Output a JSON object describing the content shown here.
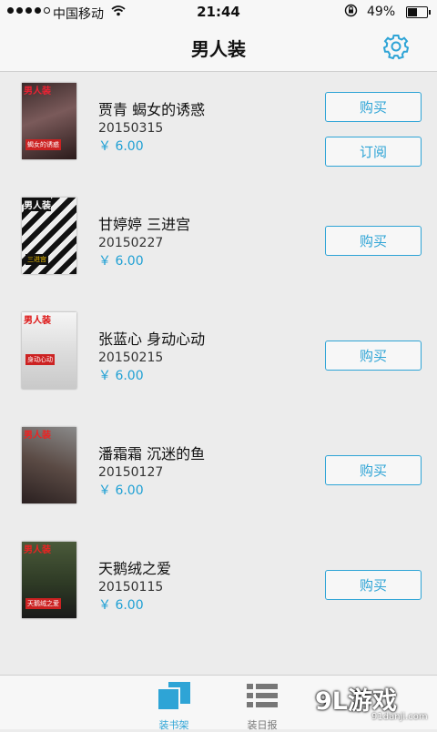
{
  "status_bar": {
    "carrier": "中国移动",
    "time": "21:44",
    "battery_pct": "49%",
    "battery_level": 0.49
  },
  "nav": {
    "title": "男人装",
    "settings_icon": "gear-icon"
  },
  "issues": [
    {
      "name": "贾青 蝎女的诱惑",
      "date": "20150315",
      "price": "￥ 6.00",
      "buttons": [
        "购买",
        "订阅"
      ],
      "cover_caption": "蝎女的诱惑"
    },
    {
      "name": "甘婷婷 三进宫",
      "date": "20150227",
      "price": "￥ 6.00",
      "buttons": [
        "购买"
      ],
      "cover_caption": "三进宫"
    },
    {
      "name": "张蓝心 身动心动",
      "date": "20150215",
      "price": "￥ 6.00",
      "buttons": [
        "购买"
      ],
      "cover_caption": "身动心动"
    },
    {
      "name": "潘霜霜 沉迷的鱼",
      "date": "20150127",
      "price": "￥ 6.00",
      "buttons": [
        "购买"
      ],
      "cover_caption": ""
    },
    {
      "name": "天鹅绒之爱",
      "date": "20150115",
      "price": "￥ 6.00",
      "buttons": [
        "购买"
      ],
      "cover_caption": "天鹅绒之爱"
    }
  ],
  "cover_masthead": "男人装",
  "tab_bar": {
    "tabs": [
      {
        "label": "装书架",
        "active": true,
        "icon": "bookshelf-icon"
      },
      {
        "label": "装日报",
        "active": false,
        "icon": "list-icon"
      }
    ]
  },
  "watermark": {
    "logo": "9L游戏",
    "site": "91danji.com"
  },
  "colors": {
    "accent": "#2ea4d6",
    "background": "#ececec",
    "bar": "#f7f7f7"
  }
}
